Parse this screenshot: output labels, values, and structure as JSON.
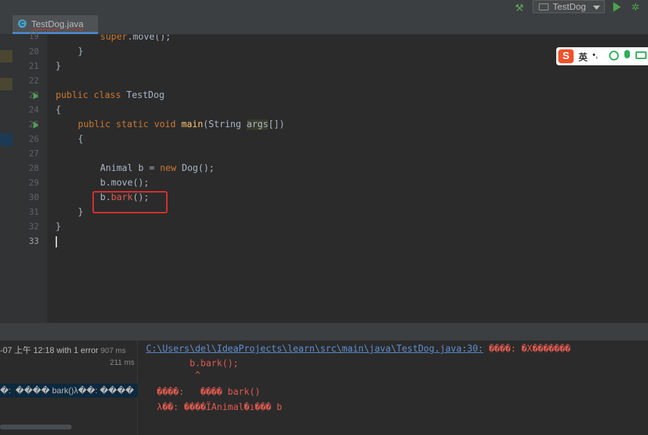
{
  "toolbar": {
    "run_config_label": "TestDog"
  },
  "tab": {
    "filename": "TestDog.java",
    "icon_letter": "C"
  },
  "editor": {
    "lines": [
      {
        "num": "19",
        "top": 0
      },
      {
        "num": "20"
      },
      {
        "num": "21"
      },
      {
        "num": "22"
      },
      {
        "num": "23"
      },
      {
        "num": "24"
      },
      {
        "num": "25"
      },
      {
        "num": "26"
      },
      {
        "num": "27"
      },
      {
        "num": "28"
      },
      {
        "num": "29"
      },
      {
        "num": "30"
      },
      {
        "num": "31"
      },
      {
        "num": "32"
      },
      {
        "num": "33"
      }
    ],
    "code": {
      "l19_kw": "super",
      "l19_rest": ".move();",
      "l20": "}",
      "l21": "}",
      "l23_kw": "public class",
      "l23_name": " TestDog",
      "l24": "{",
      "l25_kw": "public static void",
      "l25_fn": " main",
      "l25_mid": "(String ",
      "l25_param": "args",
      "l25_end": "[])",
      "l26": "{",
      "l28_a": "Animal b = ",
      "l28_kw": "new",
      "l28_b": " Dog();",
      "l29": "b.move();",
      "l30_a": "b.",
      "l30_err": "bark",
      "l30_b": "();",
      "l31": "}",
      "l32": "}"
    }
  },
  "ime": {
    "logo": "S",
    "lang": "英",
    "punct": "•,"
  },
  "build": {
    "row1_text": "-07 上午 12:18 with 1 error",
    "row1_time": "907 ms",
    "row2_time": "211 ms",
    "row3_text": "�:  ���� bark()λ��: ����"
  },
  "console": {
    "path": "C:\\Users\\del\\IdeaProjects\\learn\\src\\main\\java\\TestDog.java:30:",
    "path_msg": " ����: �X�������",
    "line2": "        b.bark();",
    "line3": "         ^",
    "line4": "  ����:   ���� bark()",
    "line5": "  λ��: ����ΪAnimal�ı��� b"
  }
}
